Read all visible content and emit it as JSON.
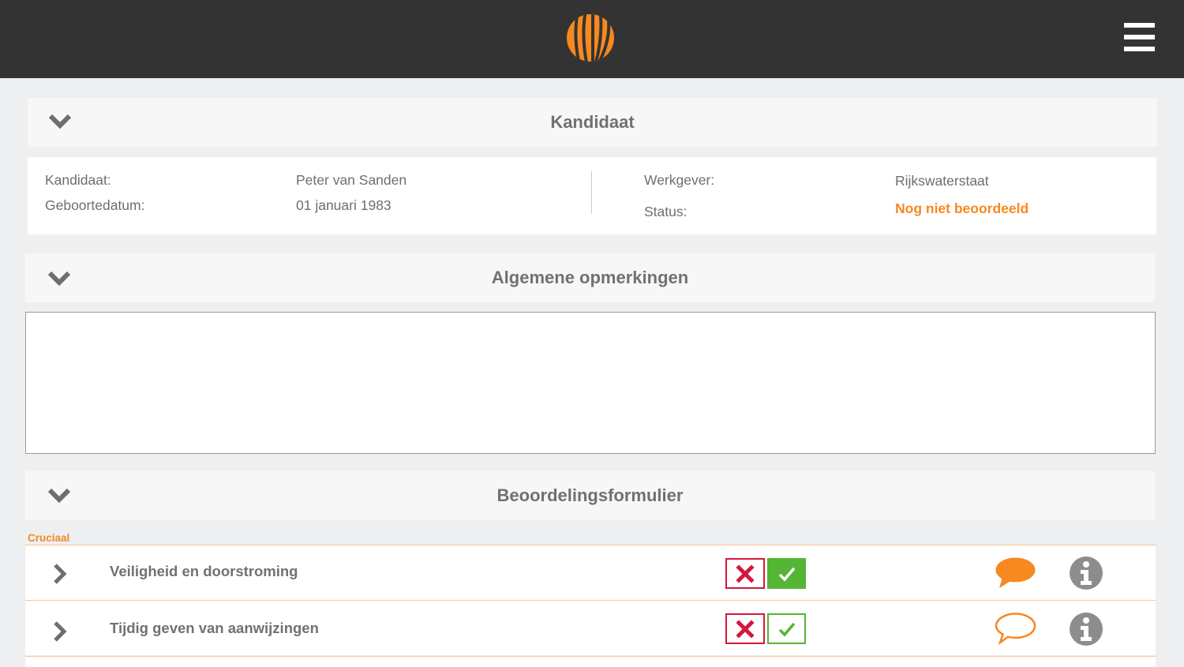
{
  "header": {
    "logo_icon": "stripes-circle-logo",
    "menu_icon": "hamburger-icon",
    "bar_color": "#333333",
    "accent_color": "#f6891f"
  },
  "kandidaat_panel": {
    "title": "Kandidaat",
    "candidate_label": "Kandidaat:",
    "candidate_value": "Peter van Sanden",
    "birthdate_label": "Geboortedatum:",
    "birthdate_value": "01 januari 1983",
    "employer_label": "Werkgever:",
    "employer_value": "Rijkswaterstaat",
    "status_label": "Status:",
    "status_value": "Nog niet beoordeeld"
  },
  "remarks_panel": {
    "title": "Algemene opmerkingen",
    "text": ""
  },
  "form_panel": {
    "title": "Beoordelingsformulier",
    "section_label": "Cruciaal",
    "items": [
      {
        "title": "Veiligheid en doorstroming",
        "passed": true,
        "has_comment": true
      },
      {
        "title": "Tijdig geven van aanwijzingen",
        "passed": false,
        "has_comment": false
      }
    ]
  }
}
